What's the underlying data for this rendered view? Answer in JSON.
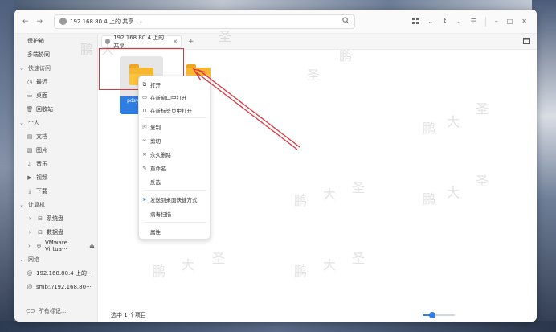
{
  "window": {
    "nav_back": "←",
    "nav_forward": "→",
    "address": "192.168.80.4 上的 共享",
    "address_chevron": "⌄",
    "search_icon": "search-icon",
    "toolbar_icons": [
      "grid-view-icon",
      "sort-icon",
      "menu-icon",
      "minimize-icon",
      "maximize-icon",
      "close-icon"
    ]
  },
  "sidebar": {
    "items": [
      {
        "label": "保护箱",
        "icon": ""
      },
      {
        "label": "多端协同",
        "icon": ""
      },
      {
        "label": "快速访问",
        "icon": "⌄",
        "head": true
      },
      {
        "label": "最近",
        "icon": "◷"
      },
      {
        "label": "桌面",
        "icon": "▭"
      },
      {
        "label": "回收站",
        "icon": "🗑"
      },
      {
        "label": "个人",
        "icon": "⌄",
        "head": true
      },
      {
        "label": "文档",
        "icon": "▤"
      },
      {
        "label": "图片",
        "icon": "▨"
      },
      {
        "label": "音乐",
        "icon": "♫"
      },
      {
        "label": "视频",
        "icon": "▶"
      },
      {
        "label": "下载",
        "icon": "⤓"
      },
      {
        "label": "计算机",
        "icon": "⌄",
        "head": true
      },
      {
        "label": "系统盘",
        "icon": "›"
      },
      {
        "label": "数据盘",
        "icon": "›"
      },
      {
        "label": "VMware Virtua···",
        "icon": "›"
      },
      {
        "label": "网络",
        "icon": "⌄",
        "head": true
      },
      {
        "label": "192.168.80.4 上的···",
        "icon": "@"
      },
      {
        "label": "smb://192.168.80···",
        "icon": "@"
      }
    ],
    "all_tags": "所有标记..."
  },
  "tabs": [
    {
      "label": "192.168.80.4 上的 共享"
    }
  ],
  "files": [
    {
      "name": "pdsywshare"
    },
    {
      "name": ""
    }
  ],
  "context_menu": {
    "items": [
      "打开",
      "在新窗口中打开",
      "在新标签页中打开",
      "复制",
      "剪切",
      "永久删除",
      "重命名",
      "反选",
      "发送到桌面快捷方式",
      "病毒扫描",
      "属性"
    ]
  },
  "status": {
    "selection": "选中 1 个项目"
  },
  "zoom_level": 0.25,
  "colors": {
    "accent": "#2f7de1",
    "annotation": "#d9363e",
    "folder": "#f7b731"
  },
  "watermark_chars": [
    "鹏",
    "大",
    "圣"
  ]
}
